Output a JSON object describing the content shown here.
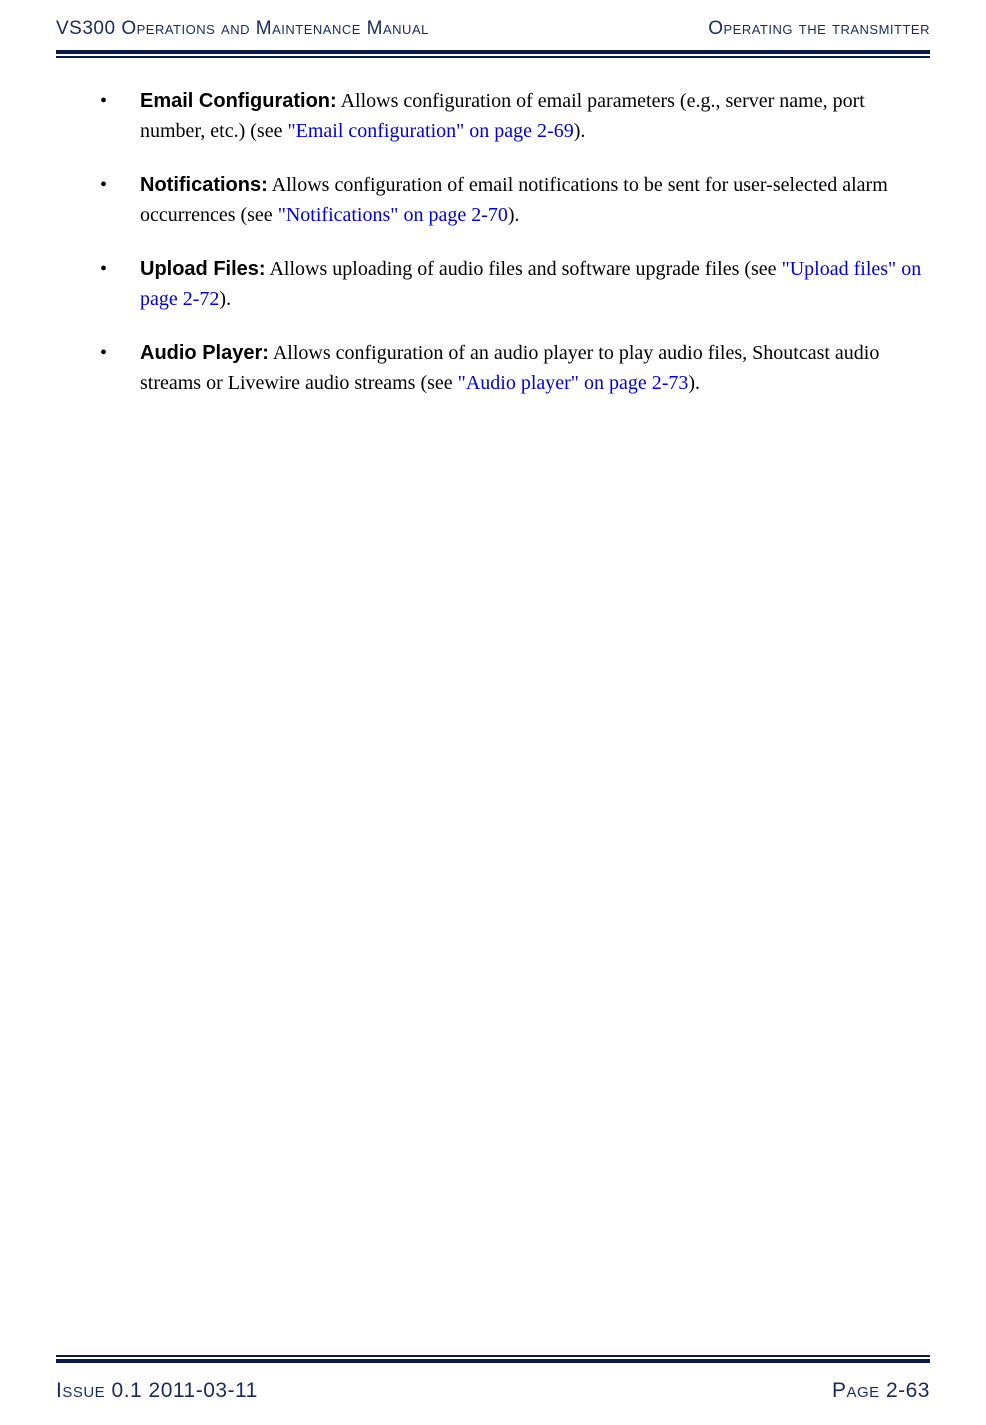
{
  "header": {
    "left": "VS300 Operations and Maintenance Manual",
    "right": "Operating the transmitter"
  },
  "bullets": [
    {
      "title": "Email Configuration:",
      "text_before_link": " Allows configuration of email parameters (e.g., server name, port number, etc.) (see ",
      "link": "\"Email configuration\" on page 2-69",
      "text_after_link": ")."
    },
    {
      "title": "Notifications:",
      "text_before_link": " Allows configuration of email notifications to be sent for user-selected alarm occurrences (see ",
      "link": "\"Notifications\" on page 2-70",
      "text_after_link": ")."
    },
    {
      "title": "Upload Files:",
      "text_before_link": " Allows uploading of audio files and software upgrade files (see ",
      "link": "\"Upload files\" on page 2-72",
      "text_after_link": ")."
    },
    {
      "title": "Audio Player:",
      "text_before_link": " Allows configuration of an audio player to play audio files, Shoutcast audio streams or Livewire audio streams (see ",
      "link": "\"Audio player\" on page 2-73",
      "text_after_link": ")."
    }
  ],
  "footer": {
    "left": "Issue 0.1  2011-03-11",
    "right": "Page 2-63"
  }
}
